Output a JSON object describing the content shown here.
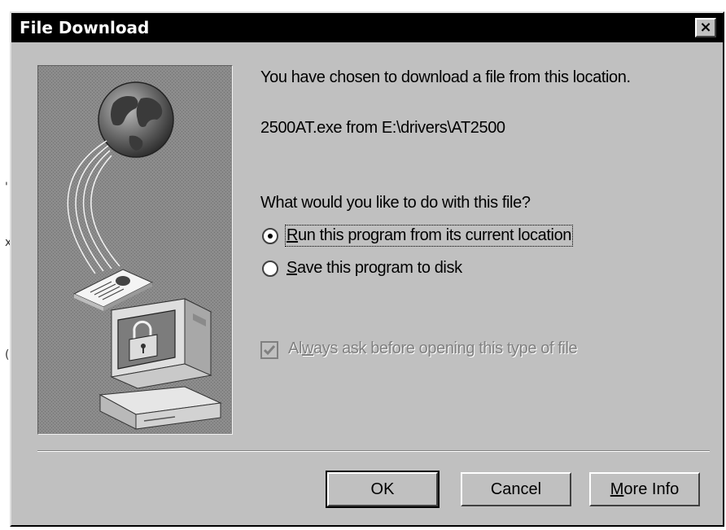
{
  "dialog": {
    "title": "File Download",
    "close_label": "×",
    "intro_text": "You have chosen to download a file from this location.",
    "file_location": "2500AT.exe from E:\\drivers\\AT2500",
    "question": "What would you like to do with this file?",
    "options": [
      {
        "mnemonic": "R",
        "rest": "un this program from its current location",
        "selected": true
      },
      {
        "mnemonic": "S",
        "rest": "ave this program to disk",
        "selected": false
      }
    ],
    "always_ask": {
      "before": "Al",
      "mnemonic": "w",
      "rest": "ays ask before opening this type of file",
      "checked": true,
      "enabled": false
    },
    "buttons": {
      "ok": "OK",
      "cancel": "Cancel",
      "more_info": {
        "mnemonic": "M",
        "rest": "ore Info"
      }
    }
  },
  "edge_marks": [
    "'",
    "x",
    "("
  ],
  "icons": [
    "globe-icon",
    "document-icon",
    "computer-icon",
    "padlock-icon",
    "checkmark-icon",
    "close-icon"
  ],
  "colors": {
    "dialog_bg": "#c0c0c0",
    "titlebar_bg": "#000000",
    "titlebar_text": "#ffffff",
    "picture_bg": "#8c8c8c"
  }
}
